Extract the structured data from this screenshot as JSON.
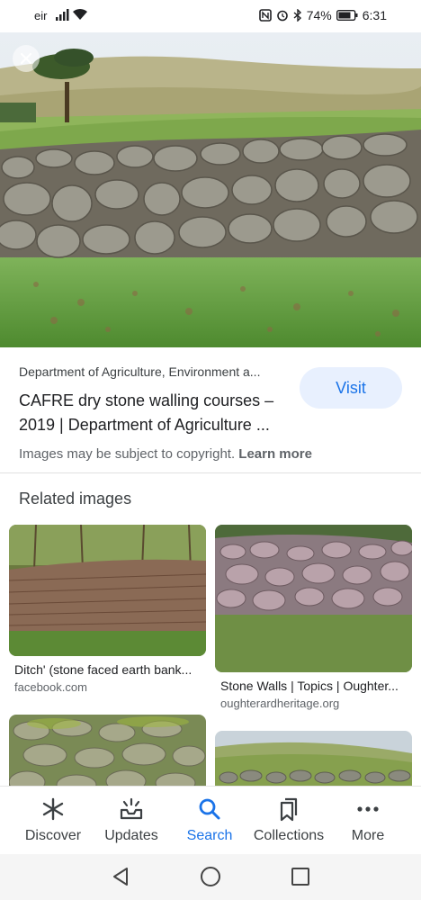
{
  "status_bar": {
    "carrier": "eir",
    "battery": "74%",
    "time": "6:31"
  },
  "viewer": {
    "close_icon": "close-icon"
  },
  "result": {
    "source": "Department of Agriculture, Environment a...",
    "title_line1": "CAFRE dry stone walling courses –",
    "title_line2": "2019 | Department of Agriculture ...",
    "visit_label": "Visit",
    "copyright_text": "Images may be subject to copyright.",
    "learn_more": "Learn more"
  },
  "related": {
    "heading": "Related images",
    "items": [
      {
        "caption": "Ditch' (stone faced earth bank...",
        "domain": "facebook.com"
      },
      {
        "caption": "Stone Walls | Topics | Oughter...",
        "domain": "oughterardheritage.org"
      },
      {
        "caption": "",
        "domain": ""
      },
      {
        "caption": "",
        "domain": ""
      }
    ]
  },
  "bottom_nav": {
    "items": [
      {
        "label": "Discover",
        "icon": "asterisk-icon"
      },
      {
        "label": "Updates",
        "icon": "inbox-icon"
      },
      {
        "label": "Search",
        "icon": "search-icon",
        "active": true
      },
      {
        "label": "Collections",
        "icon": "bookmarks-icon"
      },
      {
        "label": "More",
        "icon": "more-dots-icon"
      }
    ]
  },
  "colors": {
    "accent": "#1a73e8",
    "visit_bg": "#e8f0fe"
  }
}
